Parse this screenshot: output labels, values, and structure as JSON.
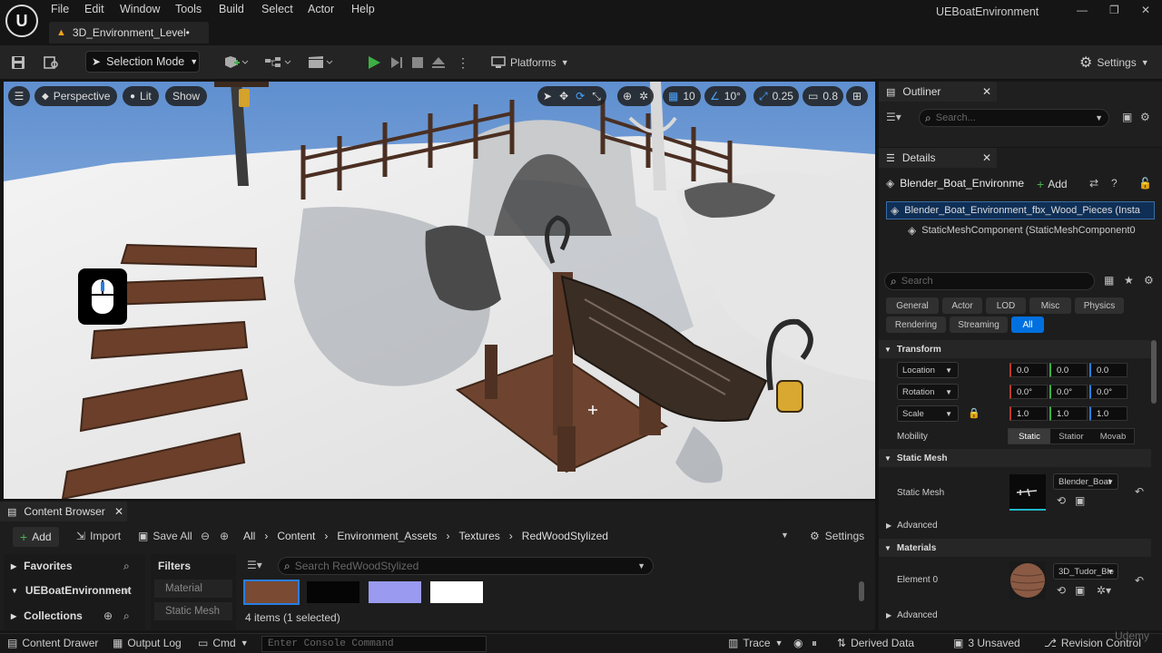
{
  "menu": {
    "items": [
      "File",
      "Edit",
      "Window",
      "Tools",
      "Build",
      "Select",
      "Actor",
      "Help"
    ]
  },
  "level_tab": {
    "label": "3D_Environment_Level•"
  },
  "app": {
    "title": "UEBoatEnvironment"
  },
  "toolbar": {
    "selection_mode": "Selection Mode",
    "platforms": "Platforms",
    "settings": "Settings"
  },
  "viewport": {
    "perspective": "Perspective",
    "lit": "Lit",
    "show": "Show",
    "grid_snap": "10",
    "rot_snap": "10°",
    "scale_snap": "0.25",
    "camera_speed": "0.8"
  },
  "outliner": {
    "title": "Outliner",
    "search_placeholder": "Search..."
  },
  "details": {
    "title": "Details",
    "actor_name": "Blender_Boat_Environme",
    "add": "Add",
    "root_component": "Blender_Boat_Environment_fbx_Wood_Pieces (Insta",
    "child_component": "StaticMeshComponent (StaticMeshComponent0",
    "search_placeholder": "Search",
    "filters": [
      "General",
      "Actor",
      "LOD",
      "Misc",
      "Physics",
      "Rendering",
      "Streaming",
      "All"
    ],
    "transform": {
      "title": "Transform",
      "location_label": "Location",
      "location": [
        "0.0",
        "0.0",
        "0.0"
      ],
      "rotation_label": "Rotation",
      "rotation": [
        "0.0°",
        "0.0°",
        "0.0°"
      ],
      "scale_label": "Scale",
      "scale": [
        "1.0",
        "1.0",
        "1.0"
      ],
      "mobility_label": "Mobility",
      "mobility": [
        "Static",
        "Statior",
        "Movab"
      ]
    },
    "static_mesh": {
      "title": "Static Mesh",
      "label": "Static Mesh",
      "value": "Blender_Boat"
    },
    "advanced": "Advanced",
    "materials": {
      "title": "Materials",
      "element_label": "Element 0",
      "value": "3D_Tudor_Ble"
    },
    "advanced2": "Advanced"
  },
  "content_browser": {
    "title": "Content Browser",
    "add": "Add",
    "import": "Import",
    "save_all": "Save All",
    "breadcrumb": [
      "All",
      "Content",
      "Environment_Assets",
      "Textures",
      "RedWoodStylized"
    ],
    "settings": "Settings",
    "sidebar": {
      "favorites": "Favorites",
      "project": "UEBoatEnvironment",
      "collections": "Collections"
    },
    "filters_title": "Filters",
    "filter_items": [
      "Material",
      "Static Mesh"
    ],
    "search_placeholder": "Search RedWoodStylized",
    "status": "4 items (1 selected)"
  },
  "statusbar": {
    "content_drawer": "Content Drawer",
    "output_log": "Output Log",
    "cmd": "Cmd",
    "console_placeholder": "Enter Console Command",
    "trace": "Trace",
    "derived_data": "Derived Data",
    "unsaved": "3 Unsaved",
    "revision_control": "Revision Control"
  },
  "watermark": "Udemy",
  "colors": {
    "accent": "#0070e0",
    "panel": "#1d1d1d",
    "sky": "#7ea6d6",
    "snow": "#eeeeee",
    "wood": "#6b3f29"
  }
}
